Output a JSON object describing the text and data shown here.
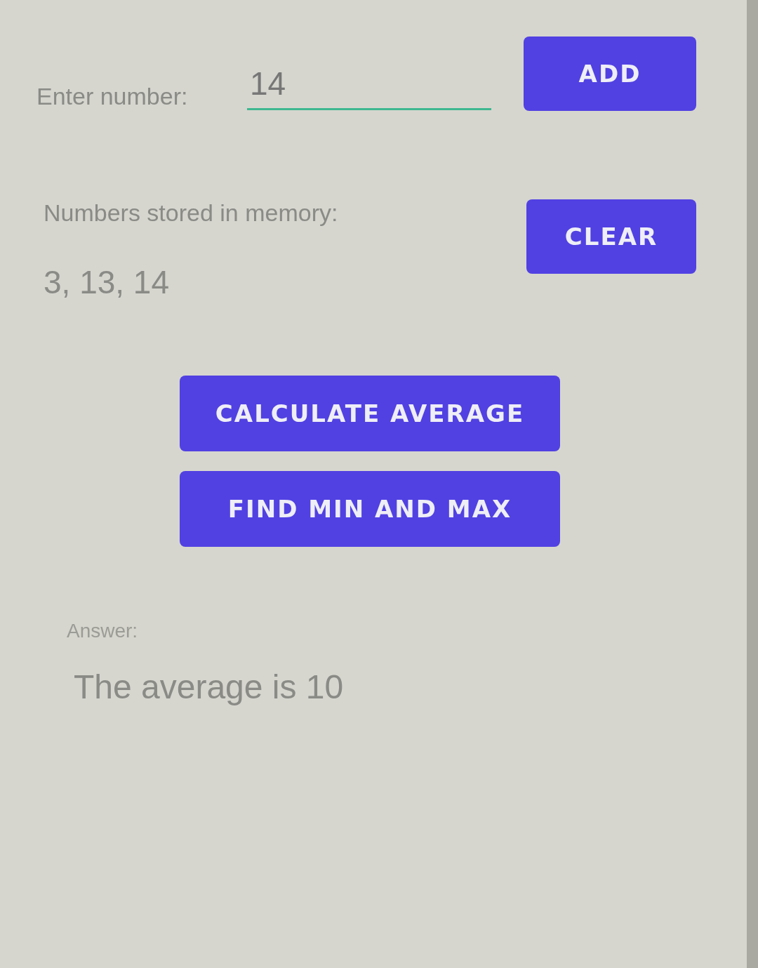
{
  "input": {
    "label": "Enter number:",
    "value": "14"
  },
  "add_button": "ADD",
  "memory": {
    "label": "Numbers stored in memory:",
    "values": "3, 13, 14"
  },
  "clear_button": "CLEAR",
  "actions": [
    "CALCULATE AVERAGE",
    "FIND MIN AND MAX"
  ],
  "answer": {
    "label": "Answer:",
    "text": "The average is 10"
  }
}
